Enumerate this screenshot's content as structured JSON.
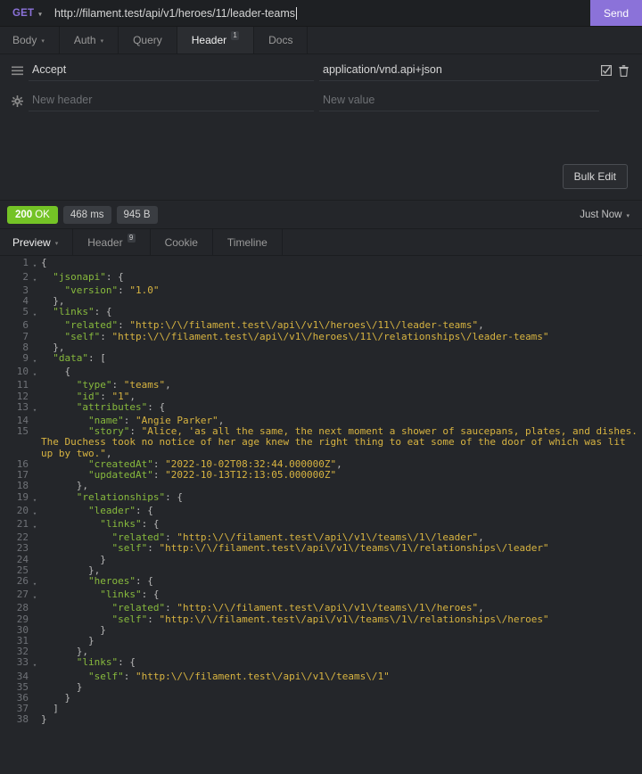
{
  "request": {
    "method": "GET",
    "method_caret": "▾",
    "url": "http://filament.test/api/v1/heroes/11/leader-teams",
    "send_label": "Send",
    "accent_purple": "#8b72d9",
    "tabs": [
      {
        "label": "Body",
        "caret": "▾",
        "active": false
      },
      {
        "label": "Auth",
        "caret": "▾",
        "active": false
      },
      {
        "label": "Query",
        "active": false
      },
      {
        "label": "Header",
        "badge": "1",
        "active": true
      },
      {
        "label": "Docs",
        "active": false
      }
    ]
  },
  "headers_panel": {
    "rows": [
      {
        "drag_icon": "hamburger-icon",
        "name": "Accept",
        "value": "application/vnd.api+json",
        "enabled": true
      },
      {
        "drag_icon": "gear-icon",
        "name_placeholder": "New header",
        "value_placeholder": "New value"
      }
    ],
    "bulk_edit_label": "Bulk Edit"
  },
  "response": {
    "status_code": "200",
    "status_text": "OK",
    "status_color": "#74c326",
    "time": "468 ms",
    "size": "945 B",
    "timestamp_label": "Just Now",
    "timestamp_caret": "▾",
    "tabs": [
      {
        "label": "Preview",
        "caret": "▾",
        "active": true
      },
      {
        "label": "Header",
        "badge": "9",
        "active": false
      },
      {
        "label": "Cookie",
        "active": false
      },
      {
        "label": "Timeline",
        "active": false
      }
    ]
  },
  "code_viewer": {
    "syntax_colors": {
      "key": "#87b93d",
      "string": "#d8b441",
      "punctuation": "#b8b8b8",
      "line_number": "#6f7277"
    },
    "lines": [
      {
        "n": 1,
        "fold": true,
        "indent": 0,
        "tokens": [
          {
            "t": "p",
            "v": "{"
          }
        ]
      },
      {
        "n": 2,
        "fold": true,
        "indent": 1,
        "tokens": [
          {
            "t": "k",
            "v": "\"jsonapi\""
          },
          {
            "t": "p",
            "v": ": {"
          }
        ]
      },
      {
        "n": 3,
        "fold": false,
        "indent": 2,
        "tokens": [
          {
            "t": "k",
            "v": "\"version\""
          },
          {
            "t": "p",
            "v": ": "
          },
          {
            "t": "s",
            "v": "\"1.0\""
          }
        ]
      },
      {
        "n": 4,
        "fold": false,
        "indent": 1,
        "tokens": [
          {
            "t": "p",
            "v": "},"
          }
        ]
      },
      {
        "n": 5,
        "fold": true,
        "indent": 1,
        "tokens": [
          {
            "t": "k",
            "v": "\"links\""
          },
          {
            "t": "p",
            "v": ": {"
          }
        ]
      },
      {
        "n": 6,
        "fold": false,
        "indent": 2,
        "tokens": [
          {
            "t": "k",
            "v": "\"related\""
          },
          {
            "t": "p",
            "v": ": "
          },
          {
            "t": "s",
            "v": "\"http:\\/\\/filament.test\\/api\\/v1\\/heroes\\/11\\/leader-teams\""
          },
          {
            "t": "p",
            "v": ","
          }
        ]
      },
      {
        "n": 7,
        "fold": false,
        "indent": 2,
        "tokens": [
          {
            "t": "k",
            "v": "\"self\""
          },
          {
            "t": "p",
            "v": ": "
          },
          {
            "t": "s",
            "v": "\"http:\\/\\/filament.test\\/api\\/v1\\/heroes\\/11\\/relationships\\/leader-teams\""
          }
        ]
      },
      {
        "n": 8,
        "fold": false,
        "indent": 1,
        "tokens": [
          {
            "t": "p",
            "v": "},"
          }
        ]
      },
      {
        "n": 9,
        "fold": true,
        "indent": 1,
        "tokens": [
          {
            "t": "k",
            "v": "\"data\""
          },
          {
            "t": "p",
            "v": ": ["
          }
        ]
      },
      {
        "n": 10,
        "fold": true,
        "indent": 2,
        "tokens": [
          {
            "t": "p",
            "v": "{"
          }
        ]
      },
      {
        "n": 11,
        "fold": false,
        "indent": 3,
        "tokens": [
          {
            "t": "k",
            "v": "\"type\""
          },
          {
            "t": "p",
            "v": ": "
          },
          {
            "t": "s",
            "v": "\"teams\""
          },
          {
            "t": "p",
            "v": ","
          }
        ]
      },
      {
        "n": 12,
        "fold": false,
        "indent": 3,
        "tokens": [
          {
            "t": "k",
            "v": "\"id\""
          },
          {
            "t": "p",
            "v": ": "
          },
          {
            "t": "s",
            "v": "\"1\""
          },
          {
            "t": "p",
            "v": ","
          }
        ]
      },
      {
        "n": 13,
        "fold": true,
        "indent": 3,
        "tokens": [
          {
            "t": "k",
            "v": "\"attributes\""
          },
          {
            "t": "p",
            "v": ": {"
          }
        ]
      },
      {
        "n": 14,
        "fold": false,
        "indent": 4,
        "tokens": [
          {
            "t": "k",
            "v": "\"name\""
          },
          {
            "t": "p",
            "v": ": "
          },
          {
            "t": "s",
            "v": "\"Angie Parker\""
          },
          {
            "t": "p",
            "v": ","
          }
        ]
      },
      {
        "n": 15,
        "fold": false,
        "indent": 4,
        "tokens": [
          {
            "t": "k",
            "v": "\"story\""
          },
          {
            "t": "p",
            "v": ": "
          },
          {
            "t": "s",
            "v": "\"Alice, 'as all the same, the next moment a shower of saucepans, plates, and dishes. The Duchess took no notice of her age knew the right thing to eat some of the door of which was lit up by two.\""
          },
          {
            "t": "p",
            "v": ","
          }
        ]
      },
      {
        "n": 16,
        "fold": false,
        "indent": 4,
        "tokens": [
          {
            "t": "k",
            "v": "\"createdAt\""
          },
          {
            "t": "p",
            "v": ": "
          },
          {
            "t": "s",
            "v": "\"2022-10-02T08:32:44.000000Z\""
          },
          {
            "t": "p",
            "v": ","
          }
        ]
      },
      {
        "n": 17,
        "fold": false,
        "indent": 4,
        "tokens": [
          {
            "t": "k",
            "v": "\"updatedAt\""
          },
          {
            "t": "p",
            "v": ": "
          },
          {
            "t": "s",
            "v": "\"2022-10-13T12:13:05.000000Z\""
          }
        ]
      },
      {
        "n": 18,
        "fold": false,
        "indent": 3,
        "tokens": [
          {
            "t": "p",
            "v": "},"
          }
        ]
      },
      {
        "n": 19,
        "fold": true,
        "indent": 3,
        "tokens": [
          {
            "t": "k",
            "v": "\"relationships\""
          },
          {
            "t": "p",
            "v": ": {"
          }
        ]
      },
      {
        "n": 20,
        "fold": true,
        "indent": 4,
        "tokens": [
          {
            "t": "k",
            "v": "\"leader\""
          },
          {
            "t": "p",
            "v": ": {"
          }
        ]
      },
      {
        "n": 21,
        "fold": true,
        "indent": 5,
        "tokens": [
          {
            "t": "k",
            "v": "\"links\""
          },
          {
            "t": "p",
            "v": ": {"
          }
        ]
      },
      {
        "n": 22,
        "fold": false,
        "indent": 6,
        "tokens": [
          {
            "t": "k",
            "v": "\"related\""
          },
          {
            "t": "p",
            "v": ": "
          },
          {
            "t": "s",
            "v": "\"http:\\/\\/filament.test\\/api\\/v1\\/teams\\/1\\/leader\""
          },
          {
            "t": "p",
            "v": ","
          }
        ]
      },
      {
        "n": 23,
        "fold": false,
        "indent": 6,
        "tokens": [
          {
            "t": "k",
            "v": "\"self\""
          },
          {
            "t": "p",
            "v": ": "
          },
          {
            "t": "s",
            "v": "\"http:\\/\\/filament.test\\/api\\/v1\\/teams\\/1\\/relationships\\/leader\""
          }
        ]
      },
      {
        "n": 24,
        "fold": false,
        "indent": 5,
        "tokens": [
          {
            "t": "p",
            "v": "}"
          }
        ]
      },
      {
        "n": 25,
        "fold": false,
        "indent": 4,
        "tokens": [
          {
            "t": "p",
            "v": "},"
          }
        ]
      },
      {
        "n": 26,
        "fold": true,
        "indent": 4,
        "tokens": [
          {
            "t": "k",
            "v": "\"heroes\""
          },
          {
            "t": "p",
            "v": ": {"
          }
        ]
      },
      {
        "n": 27,
        "fold": true,
        "indent": 5,
        "tokens": [
          {
            "t": "k",
            "v": "\"links\""
          },
          {
            "t": "p",
            "v": ": {"
          }
        ]
      },
      {
        "n": 28,
        "fold": false,
        "indent": 6,
        "tokens": [
          {
            "t": "k",
            "v": "\"related\""
          },
          {
            "t": "p",
            "v": ": "
          },
          {
            "t": "s",
            "v": "\"http:\\/\\/filament.test\\/api\\/v1\\/teams\\/1\\/heroes\""
          },
          {
            "t": "p",
            "v": ","
          }
        ]
      },
      {
        "n": 29,
        "fold": false,
        "indent": 6,
        "tokens": [
          {
            "t": "k",
            "v": "\"self\""
          },
          {
            "t": "p",
            "v": ": "
          },
          {
            "t": "s",
            "v": "\"http:\\/\\/filament.test\\/api\\/v1\\/teams\\/1\\/relationships\\/heroes\""
          }
        ]
      },
      {
        "n": 30,
        "fold": false,
        "indent": 5,
        "tokens": [
          {
            "t": "p",
            "v": "}"
          }
        ]
      },
      {
        "n": 31,
        "fold": false,
        "indent": 4,
        "tokens": [
          {
            "t": "p",
            "v": "}"
          }
        ]
      },
      {
        "n": 32,
        "fold": false,
        "indent": 3,
        "tokens": [
          {
            "t": "p",
            "v": "},"
          }
        ]
      },
      {
        "n": 33,
        "fold": true,
        "indent": 3,
        "tokens": [
          {
            "t": "k",
            "v": "\"links\""
          },
          {
            "t": "p",
            "v": ": {"
          }
        ]
      },
      {
        "n": 34,
        "fold": false,
        "indent": 4,
        "tokens": [
          {
            "t": "k",
            "v": "\"self\""
          },
          {
            "t": "p",
            "v": ": "
          },
          {
            "t": "s",
            "v": "\"http:\\/\\/filament.test\\/api\\/v1\\/teams\\/1\""
          }
        ]
      },
      {
        "n": 35,
        "fold": false,
        "indent": 3,
        "tokens": [
          {
            "t": "p",
            "v": "}"
          }
        ]
      },
      {
        "n": 36,
        "fold": false,
        "indent": 2,
        "tokens": [
          {
            "t": "p",
            "v": "}"
          }
        ]
      },
      {
        "n": 37,
        "fold": false,
        "indent": 1,
        "tokens": [
          {
            "t": "p",
            "v": "]"
          }
        ]
      },
      {
        "n": 38,
        "fold": false,
        "indent": 0,
        "tokens": [
          {
            "t": "p",
            "v": "}"
          }
        ]
      }
    ]
  }
}
